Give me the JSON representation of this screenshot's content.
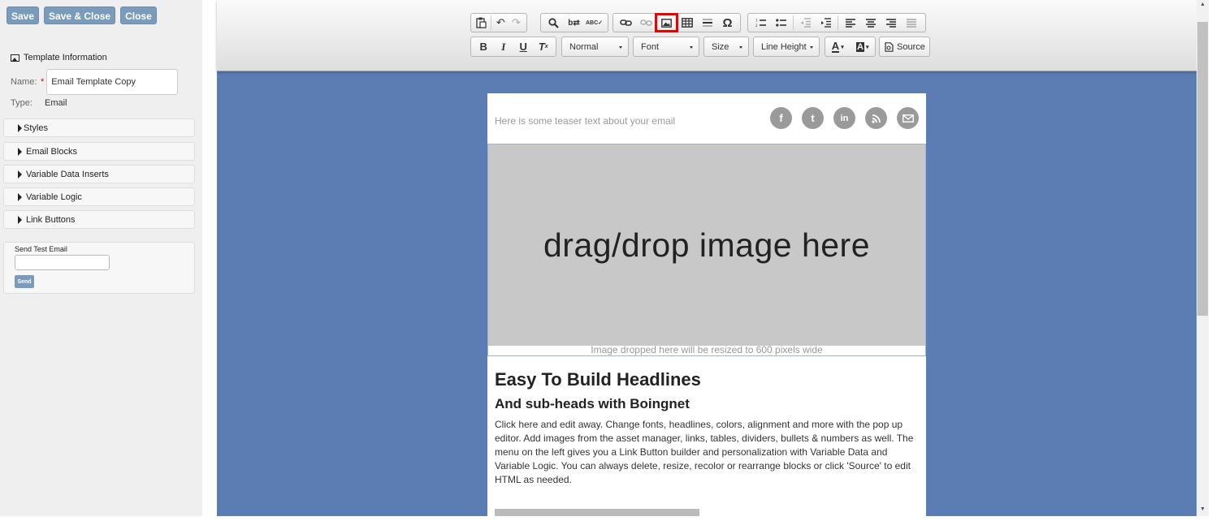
{
  "left_panel": {
    "buttons": {
      "save": "Save",
      "save_close": "Save & Close",
      "close": "Close"
    },
    "template_info": {
      "title": "Template Information",
      "name_label": "Name:",
      "required_mark": "*",
      "name_value": "Email Template Copy",
      "type_label": "Type:",
      "type_value": "Email"
    },
    "sections": [
      "Styles",
      "Email Blocks",
      "Variable Data Inserts",
      "Variable Logic",
      "Link Buttons"
    ],
    "send_test": {
      "title": "Send Test Email",
      "input_value": "",
      "send_label": "Send"
    }
  },
  "toolbar": {
    "row1_icons": [
      "paste-from-word",
      "undo",
      "redo",
      "find",
      "replace",
      "spellcheck",
      "link",
      "unlink",
      "image",
      "table",
      "horizontal-line",
      "special-char",
      "numbered-list",
      "bulleted-list",
      "outdent",
      "indent",
      "align-left",
      "align-center",
      "align-right",
      "justify"
    ],
    "highlighted_icon": "image",
    "bold": "B",
    "italic": "I",
    "underline": "U",
    "format_value": "Normal",
    "font_value": "Font",
    "size_value": "Size",
    "line_height_value": "Line Height",
    "text_color_glyph": "A",
    "bg_color_glyph": "A",
    "source_label": "Source"
  },
  "email": {
    "teaser": "Here is some teaser text about your email",
    "social": [
      "facebook",
      "tumblr",
      "linkedin",
      "rss",
      "email"
    ],
    "drop_text": "drag/drop image here",
    "drop_note": "Image dropped here will be resized to 600 pixels wide",
    "headline": "Easy To Build Headlines",
    "subhead": "And sub-heads with Boingnet",
    "body": "Click here and edit away. Change fonts, headlines, colors, alignment and more with the pop up editor. Add images from the asset manager, links, tables, dividers, bullets & numbers as well. The menu on the left gives you a Link Button builder and personalization with Variable Data and Variable Logic. You can always delete, resize, recolor or rearrange blocks or click 'Source' to edit HTML as needed."
  },
  "colors": {
    "editor_bg": "#5b7db3",
    "button_blue": "#7a9cba",
    "highlight_red": "#e00000"
  }
}
